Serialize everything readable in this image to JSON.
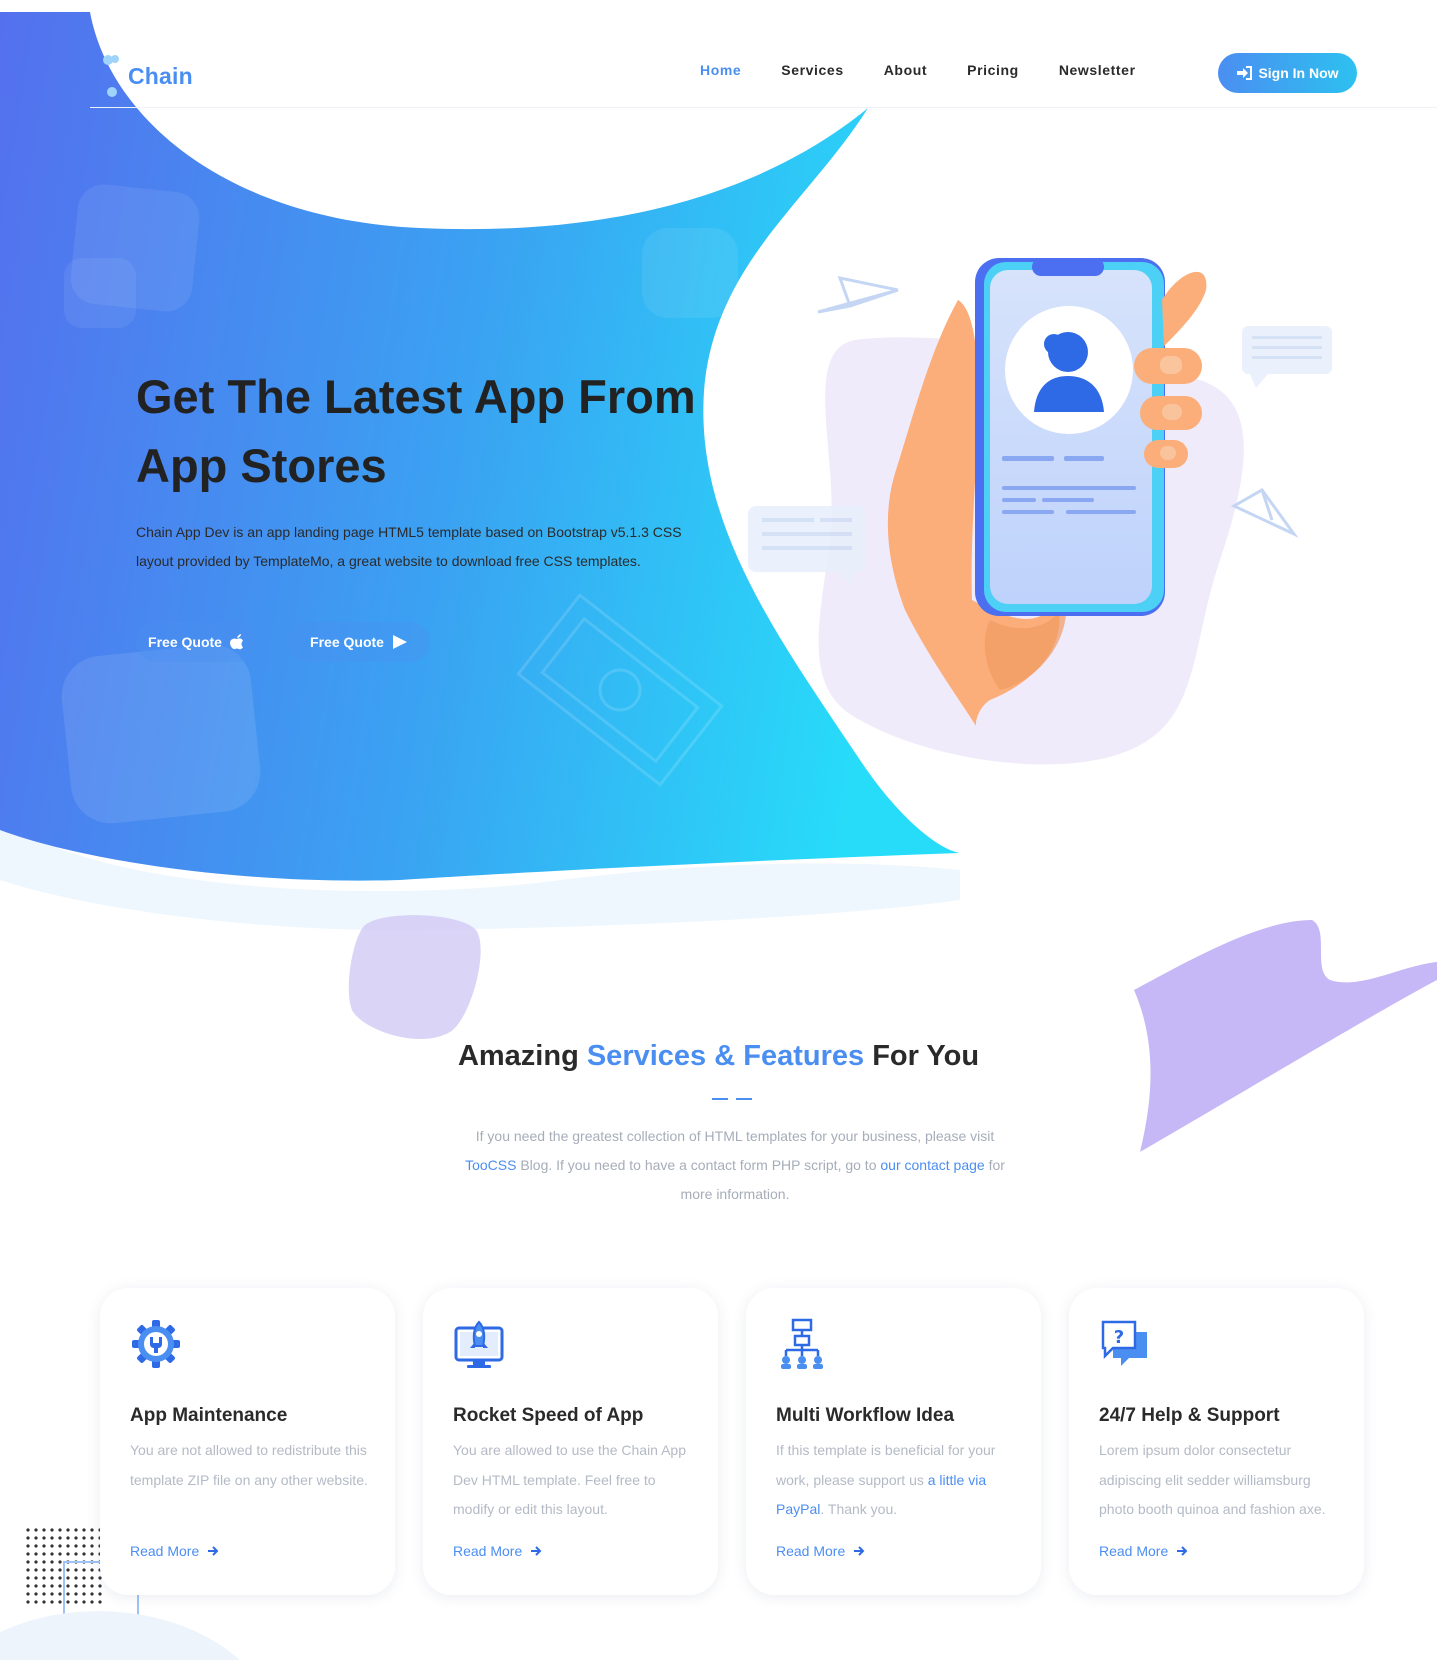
{
  "brand": {
    "name": "Chain"
  },
  "nav": {
    "items": [
      "Home",
      "Services",
      "About",
      "Pricing",
      "Newsletter"
    ],
    "active": "Home",
    "signin_label": "Sign In Now"
  },
  "hero": {
    "title_line1": "Get The Latest App From",
    "title_line2": "App Stores",
    "description": "Chain App Dev is an app landing page HTML5 template based on Bootstrap v5.1.3 CSS layout provided by TemplateMo, a great website to download free CSS templates.",
    "buttons": [
      {
        "label": "Free Quote",
        "icon": "apple-icon"
      },
      {
        "label": "Free Quote",
        "icon": "play-store-icon"
      }
    ]
  },
  "services": {
    "title_prefix": "Amazing",
    "title_highlight": "Services & Features",
    "title_suffix": "For You",
    "desc_part1": "If you need the greatest collection of HTML templates for your business, please visit",
    "desc_link1": "TooCSS",
    "desc_part2": "Blog. If you need to have a contact form PHP script, go to",
    "desc_link2": "our contact page",
    "desc_part3": "for more information.",
    "cards": [
      {
        "icon": "gear-wrench-icon",
        "title": "App Maintenance",
        "text": "You are not allowed to redistribute this template ZIP file on any other website.",
        "link": "Read More"
      },
      {
        "icon": "rocket-monitor-icon",
        "title": "Rocket Speed of App",
        "text": "You are allowed to use the Chain App Dev HTML template. Feel free to modify or edit this layout.",
        "link": "Read More"
      },
      {
        "icon": "workflow-hierarchy-icon",
        "title": "Multi Workflow Idea",
        "text_part1": "If this template is beneficial for your work, please support us",
        "text_link": "a little via PayPal",
        "text_part2": ". Thank you.",
        "link": "Read More"
      },
      {
        "icon": "help-chat-icon",
        "title": "24/7 Help & Support",
        "text": "Lorem ipsum dolor consectetur adipiscing elit sedder williamsburg photo booth quinoa and fashion axe.",
        "link": "Read More"
      }
    ]
  },
  "colors": {
    "accent": "#4b8ef1",
    "accent_light": "#2dc1f0",
    "hero_gradient_start": "#4f6ff0",
    "hero_gradient_end": "#2ad6f8",
    "text_dark": "#2a2a2a",
    "text_muted": "#a6adb9"
  }
}
